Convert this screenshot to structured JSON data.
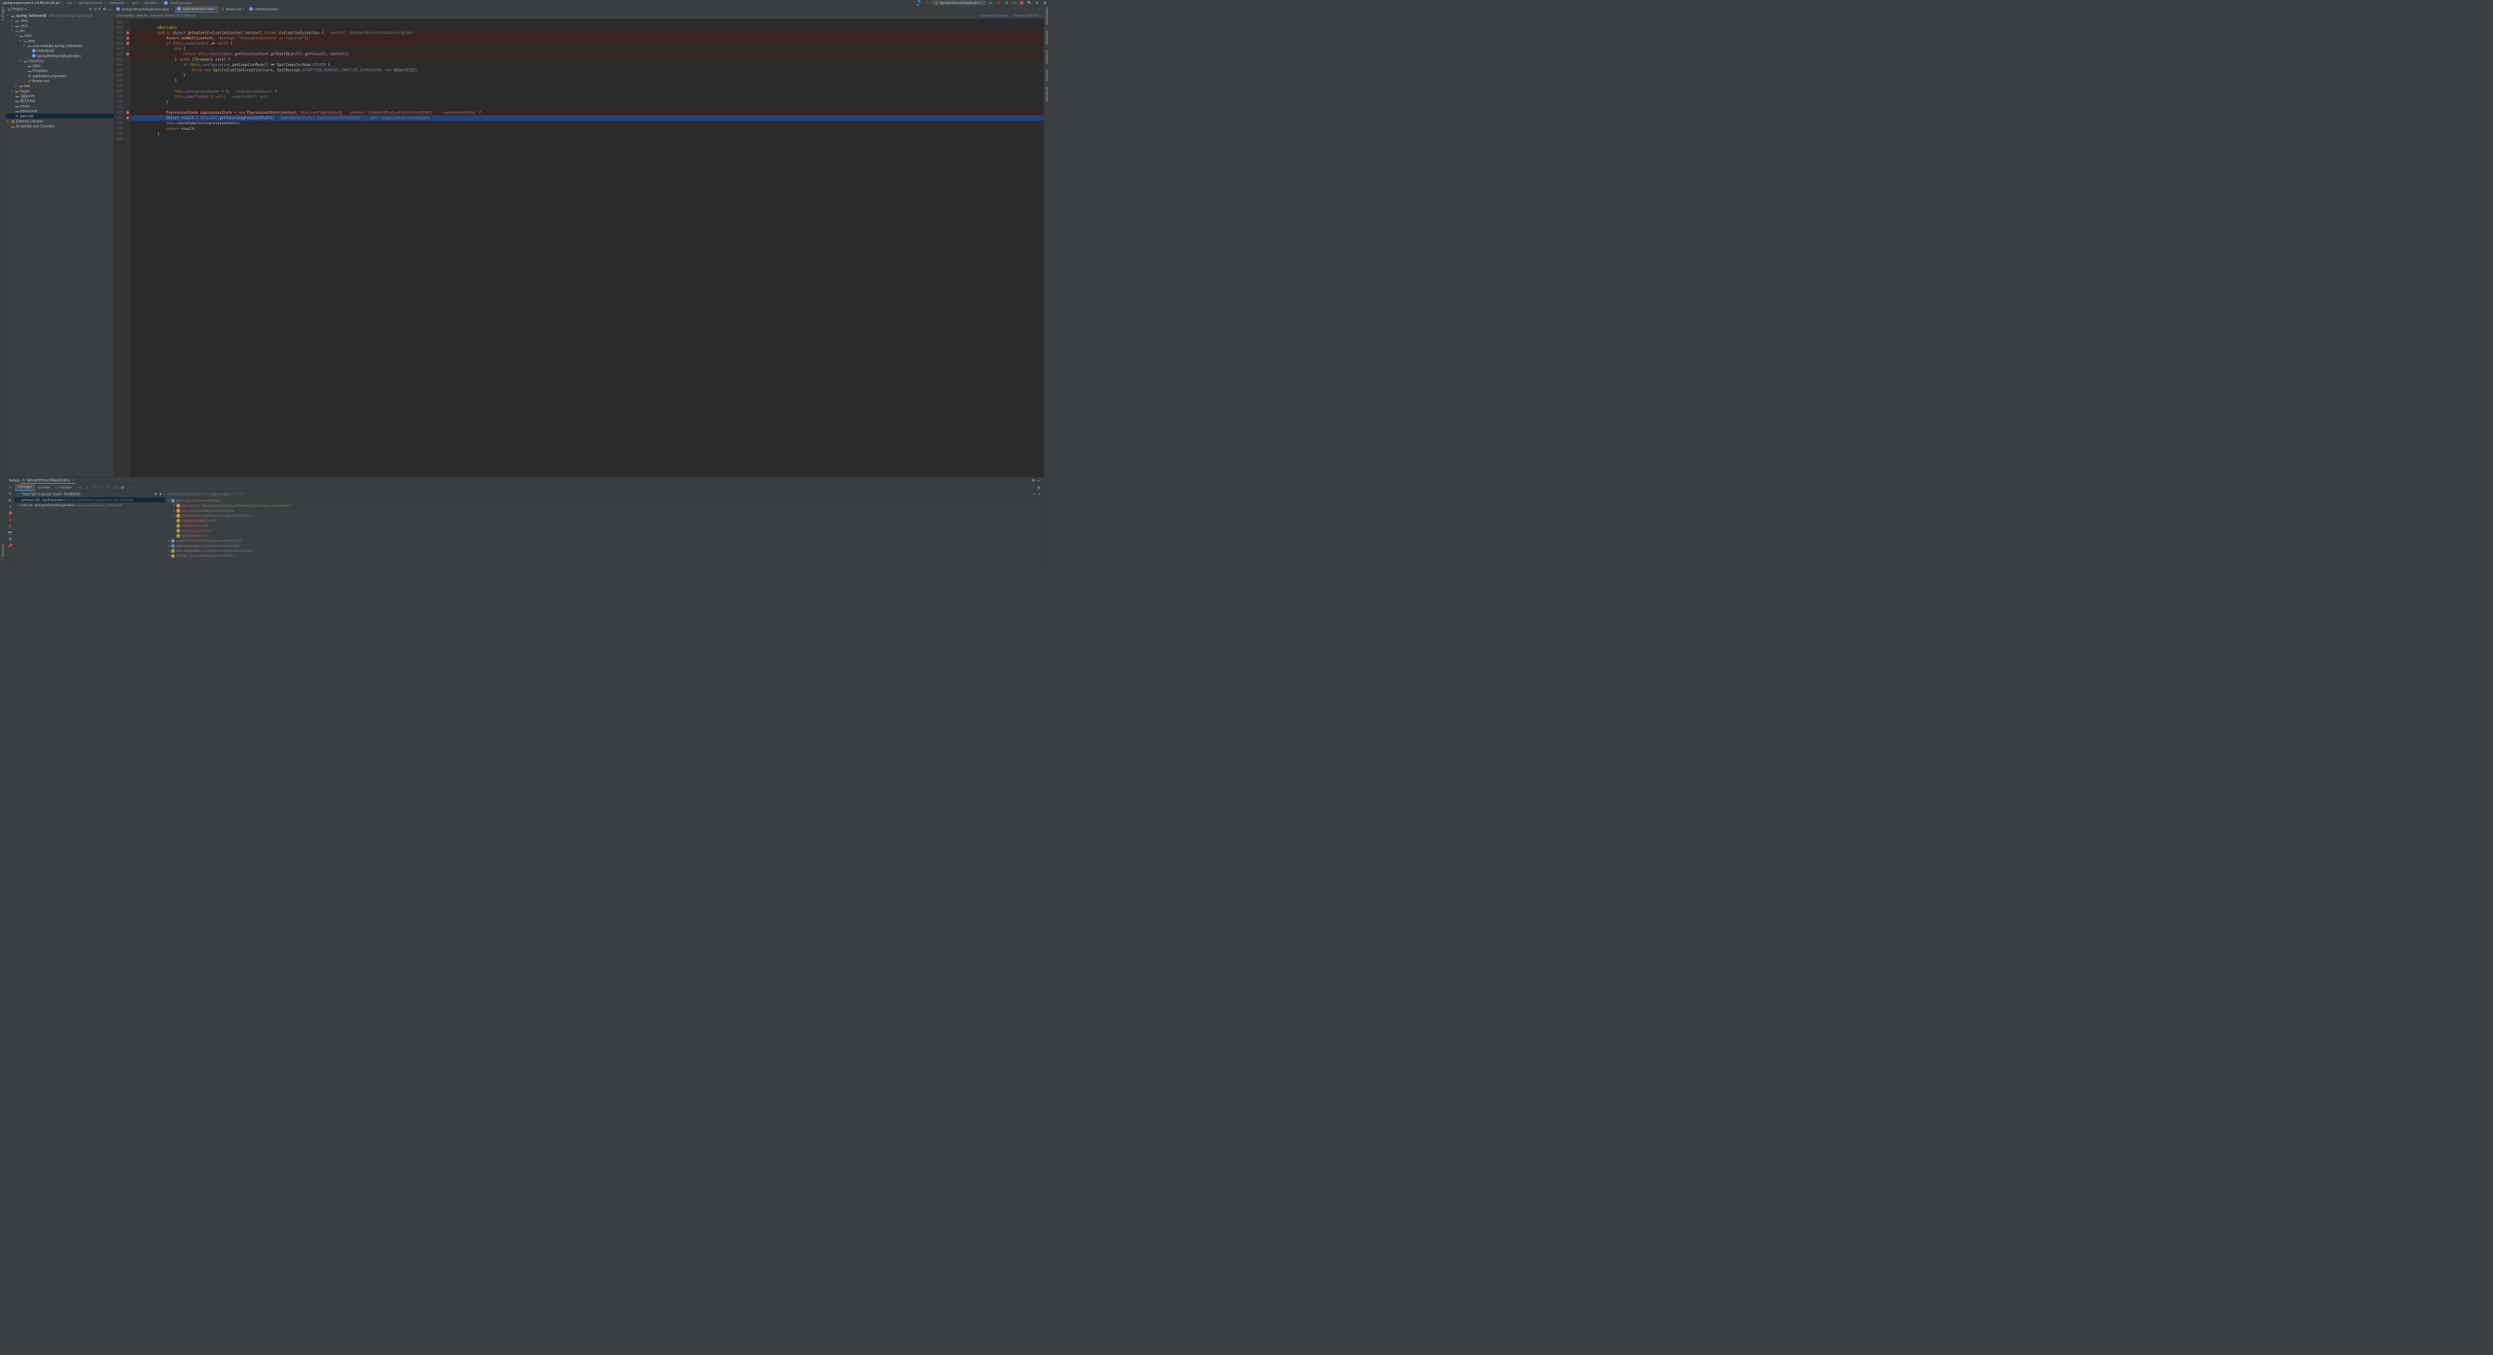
{
  "breadcrumb": {
    "jar": "spring-expression-5.1.9.RELEASE.jar",
    "parts": [
      "org",
      "springframework",
      "expression",
      "spel",
      "standard"
    ],
    "class": "SpelExpression"
  },
  "runConfig": "SpringHelloworldApplication",
  "projectPanel": {
    "title": "Project",
    "tree": [
      {
        "depth": 0,
        "arrow": "▾",
        "icon": "folder",
        "label": "spring_helloworld",
        "suffix": "~/Projects/spring_helloworld",
        "bold": true
      },
      {
        "depth": 1,
        "arrow": "▸",
        "icon": "folder",
        "label": ".idea"
      },
      {
        "depth": 1,
        "arrow": "▸",
        "icon": "folder",
        "label": ".mvn"
      },
      {
        "depth": 1,
        "arrow": "▾",
        "icon": "blue-folder",
        "label": "src"
      },
      {
        "depth": 2,
        "arrow": "▾",
        "icon": "folder",
        "label": "main"
      },
      {
        "depth": 3,
        "arrow": "▾",
        "icon": "blue-folder",
        "label": "java"
      },
      {
        "depth": 4,
        "arrow": "▾",
        "icon": "pkg",
        "label": "com.example.spring_helloworld"
      },
      {
        "depth": 5,
        "arrow": "",
        "icon": "java",
        "label": "HelloWorld"
      },
      {
        "depth": 5,
        "arrow": "",
        "icon": "java",
        "label": "SpringHelloworldApplication"
      },
      {
        "depth": 3,
        "arrow": "▾",
        "icon": "pkg",
        "label": "resources"
      },
      {
        "depth": 4,
        "arrow": "",
        "icon": "folder",
        "label": "static"
      },
      {
        "depth": 4,
        "arrow": "",
        "icon": "folder",
        "label": "templates"
      },
      {
        "depth": 4,
        "arrow": "",
        "icon": "spring",
        "label": "application.properties"
      },
      {
        "depth": 4,
        "arrow": "",
        "icon": "xml",
        "label": "Beans.xml"
      },
      {
        "depth": 2,
        "arrow": "▸",
        "icon": "folder",
        "label": "test"
      },
      {
        "depth": 1,
        "arrow": "▸",
        "icon": "folder",
        "label": "target"
      },
      {
        "depth": 1,
        "arrow": "",
        "icon": "file",
        "label": ".gitignore"
      },
      {
        "depth": 1,
        "arrow": "",
        "icon": "file",
        "label": "HELP.md"
      },
      {
        "depth": 1,
        "arrow": "",
        "icon": "file",
        "label": "mvnw"
      },
      {
        "depth": 1,
        "arrow": "",
        "icon": "file",
        "label": "mvnw.cmd"
      },
      {
        "depth": 1,
        "arrow": "",
        "icon": "maven",
        "label": "pom.xml",
        "selected": true
      },
      {
        "depth": 0,
        "arrow": "▸",
        "icon": "lib",
        "label": "External Libraries"
      },
      {
        "depth": 0,
        "arrow": "",
        "icon": "scratch",
        "label": "Scratches and Consoles"
      }
    ]
  },
  "editorTabs": [
    {
      "icon": "java",
      "label": "SpringHelloworldApplication.java",
      "active": false
    },
    {
      "icon": "java",
      "label": "SpelExpression.class",
      "active": true
    },
    {
      "icon": "xml",
      "label": "Beans.xml",
      "active": false
    },
    {
      "icon": "java",
      "label": "HelloWorld.java",
      "active": false
    }
  ],
  "infoBar": {
    "text": "Decompiled .class file, bytecode version: 52.0 (Java 8)",
    "link1": "Download Sources",
    "link2": "Choose Sources..."
  },
  "code": {
    "startLine": 156,
    "lines": [
      {
        "n": 156,
        "html": ""
      },
      {
        "n": 157,
        "html": "            <span class='ann'>@Nullable</span>"
      },
      {
        "n": 158,
        "bp": true,
        "html": "            <span class='kw'>public</span> <span class='type'>Object</span> <span class='fn'>getValue</span>(EvaluationContext context) <span class='kw'>throws</span> EvaluationException {   <span class='comment'>context: StandardEvaluationContext@1841</span>"
      },
      {
        "n": 159,
        "bp": true,
        "html": "                Assert.<span class='fn'>notNull</span>(context,  <span class='comment'>message:</span> <span class='str'>\"EvaluationContext is required\"</span>);"
      },
      {
        "n": 160,
        "bp": true,
        "html": "                <span class='kw'>if</span> (<span class='kw'>this</span>.<span class='field'>compiledAst</span> != <span class='kw'>null</span>) {"
      },
      {
        "n": 161,
        "html": "                    <span class='kw'>try</span> {"
      },
      {
        "n": 162,
        "bp": true,
        "html": "                        <span class='kw'>return</span> <span class='kw'>this</span>.<span class='field'>compiledAst</span>.getValue(context.getRootObject().getValue(), context);"
      },
      {
        "n": 163,
        "html": "                    } <span class='kw'>catch</span> (Throwable var4) {"
      },
      {
        "n": 164,
        "html": "                        <span class='kw'>if</span> (<span class='kw'>this</span>.<span class='field'>configuration</span>.getCompilerMode() != SpelCompilerMode.<span class='const'>MIXED</span>) {"
      },
      {
        "n": 165,
        "html": "                            <span class='kw'>throw</span> <span class='kw'>new</span> SpelEvaluationException(var4, SpelMessage.<span class='const'>EXCEPTION_RUNNING_COMPILED_EXPRESSION</span>, <span class='kw'>new</span> Object[<span class='num'>0</span>]);"
      },
      {
        "n": 166,
        "html": "                        }"
      },
      {
        "n": 167,
        "html": "                    }"
      },
      {
        "n": 168,
        "html": ""
      },
      {
        "n": 169,
        "html": "                    <span class='kw'>this</span>.<span class='field'>interpretedCount</span> = <span class='num'>0</span>;   <span class='comment'>interpretedCount: 0</span>"
      },
      {
        "n": 170,
        "html": "                    <span class='kw'>this</span>.<span class='field'>compiledAst</span> = <span class='kw'>null</span>;   <span class='comment'>compiledAst: null</span>"
      },
      {
        "n": 171,
        "html": "                }"
      },
      {
        "n": 172,
        "html": ""
      },
      {
        "n": 173,
        "bp": true,
        "html": "                ExpressionState expressionState = <span class='kw'>new</span> ExpressionState(context, <span class='kw'>this</span>.<span class='field'>configuration</span>);   <span class='comment'>context: StandardEvaluationContext@1841     expressionState: E</span>"
      },
      {
        "n": 174,
        "bp": true,
        "current": true,
        "html": "                Object result = <span class='kw'>this</span>.<span class='field'>ast</span>.getValue(expressionState);   <span class='comment'>expressionState: ExpressionState@1853     ast: CompoundExpression@1844</span>"
      },
      {
        "n": 175,
        "html": "                <span class='kw'>this</span>.checkCompile(expressionState);"
      },
      {
        "n": 176,
        "html": "                <span class='kw'>return</span> result;"
      },
      {
        "n": 177,
        "html": "            }"
      },
      {
        "n": 178,
        "html": ""
      }
    ]
  },
  "debug": {
    "title": "Debug:",
    "config": "SpringHelloworldApplication",
    "tabs": {
      "debugger": "Debugger",
      "console": "Console",
      "actuator": "Actuator"
    },
    "threadStatus": "\"main\"@1 in group \"main\": RUNNING",
    "frames": [
      {
        "loc": "getValue:265, SpelExpression",
        "pkg": "(org.springframework.expression.spel.standard)",
        "selected": true
      },
      {
        "loc": "main:23, SpringHelloworldApplication",
        "pkg": "(com.example.spring_helloworld)"
      }
    ],
    "watchPlaceholder": "Evaluate expression (⏎) or add a watch (⌃⇧⏎)",
    "vars": [
      {
        "depth": 0,
        "arrow": "▾",
        "icon": "blue",
        "iconTxt": "≡",
        "name": "this",
        "val": "{SpelExpression@1842}",
        "cls": "obj"
      },
      {
        "depth": 1,
        "arrow": "▸",
        "icon": "orange",
        "iconTxt": "f",
        "name": "expression",
        "val": "\"T(java.lang.Runtime).getRuntime().exec(\"open -a Calculator\")\"",
        "cls": "str",
        "red": true
      },
      {
        "depth": 1,
        "arrow": "▸",
        "icon": "orange",
        "iconTxt": "f",
        "name": "ast",
        "val": "{CompoundExpression@1844}",
        "cls": "obj",
        "red": true
      },
      {
        "depth": 1,
        "arrow": "▸",
        "icon": "orange",
        "iconTxt": "f",
        "name": "configuration",
        "val": "{SpelParserConfiguration@1843}",
        "cls": "obj",
        "red": true
      },
      {
        "depth": 1,
        "arrow": "",
        "icon": "yellow",
        "iconTxt": "f",
        "name": "evaluationContext",
        "val": "null",
        "cls": "obj",
        "red": true
      },
      {
        "depth": 1,
        "arrow": "",
        "icon": "yellow",
        "iconTxt": "f",
        "name": "compiledAst",
        "val": "null",
        "cls": "obj",
        "red": true
      },
      {
        "depth": 1,
        "arrow": "",
        "icon": "yellow",
        "iconTxt": "f",
        "name": "interpretedCount",
        "val": "0",
        "cls": "obj",
        "red": true
      },
      {
        "depth": 1,
        "arrow": "",
        "icon": "yellow",
        "iconTxt": "f",
        "name": "failedAttempts",
        "val": "0",
        "cls": "obj",
        "red": true
      },
      {
        "depth": 0,
        "arrow": "▸",
        "icon": "purple",
        "iconTxt": "p",
        "name": "context",
        "val": "{StandardEvaluationContext@1841}",
        "cls": "obj"
      },
      {
        "depth": 0,
        "arrow": "▸",
        "icon": "blue",
        "iconTxt": "≡",
        "name": "expressionState",
        "val": "{ExpressionState@1853}",
        "cls": "obj"
      },
      {
        "depth": 0,
        "arrow": "▸",
        "icon": "inf",
        "iconTxt": "∞",
        "name": "this.configuration",
        "val": "{SpelParserConfiguration@1843}",
        "cls": "obj"
      },
      {
        "depth": 0,
        "arrow": "▸",
        "icon": "inf",
        "iconTxt": "∞",
        "name": "this.ast",
        "val": "{CompoundExpression@1844}",
        "cls": "obj"
      }
    ]
  }
}
